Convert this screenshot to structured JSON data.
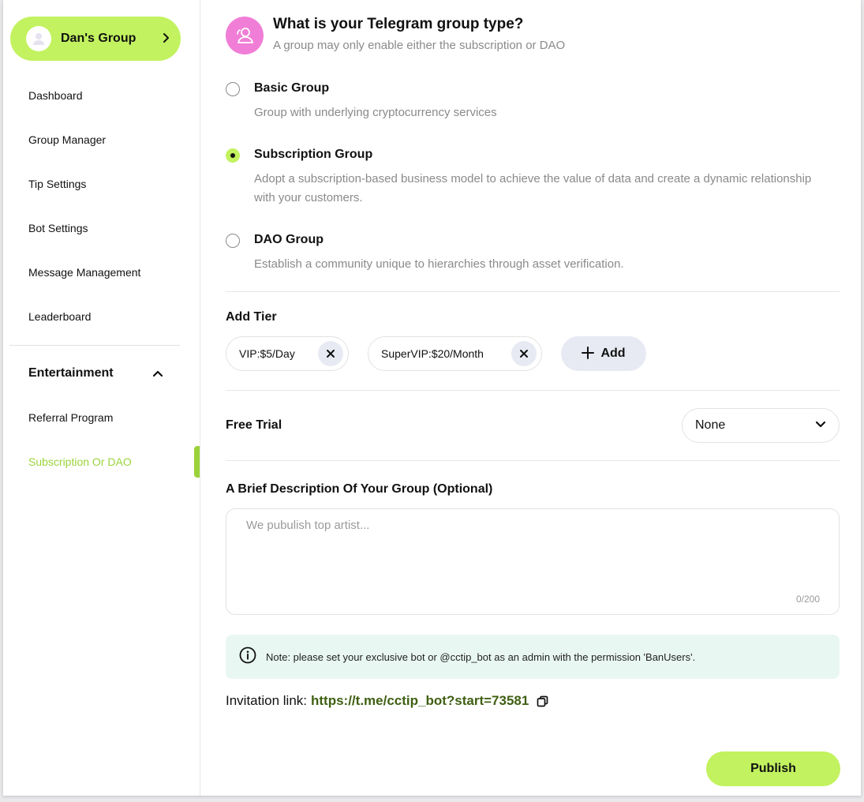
{
  "sidebar": {
    "group_name": "Dan's Group",
    "items": [
      "Dashboard",
      "Group Manager",
      "Tip Settings",
      "Bot Settings",
      "Message Management",
      "Leaderboard"
    ],
    "section_title": "Entertainment",
    "section_items": [
      "Referral Program",
      "Subscription Or DAO"
    ],
    "active_item": "Subscription Or DAO"
  },
  "header": {
    "title": "What is your Telegram group type?",
    "subtitle": "A group may only enable either the subscription or DAO"
  },
  "group_types": [
    {
      "title": "Basic Group",
      "desc": "Group with underlying cryptocurrency services",
      "checked": false
    },
    {
      "title": "Subscription Group",
      "desc": "Adopt a subscription-based business model to achieve the value of data and create a dynamic relationship with your customers.",
      "checked": true
    },
    {
      "title": "DAO Group",
      "desc": "Establish a community unique to hierarchies through asset verification.",
      "checked": false
    }
  ],
  "tiers": {
    "label": "Add Tier",
    "items": [
      "VIP:$5/Day",
      "SuperVIP:$20/Month"
    ],
    "add_label": "Add"
  },
  "free_trial": {
    "label": "Free Trial",
    "value": "None"
  },
  "description": {
    "label": "A Brief Description Of Your Group (Optional)",
    "placeholder": "We pubulish top artist...",
    "counter": "0/200"
  },
  "note": {
    "text": "Note: please set your exclusive bot or @cctip_bot as an admin with the permission 'BanUsers'."
  },
  "invitation": {
    "label": "Invitation link:",
    "url": "https://t.me/cctip_bot?start=73581"
  },
  "publish_label": "Publish",
  "colors": {
    "accent": "#c2f25f",
    "active_text": "#9bd23a",
    "header_icon": "#f07ed7",
    "link": "#3f5f12",
    "note_bg": "#e9f7f3"
  }
}
